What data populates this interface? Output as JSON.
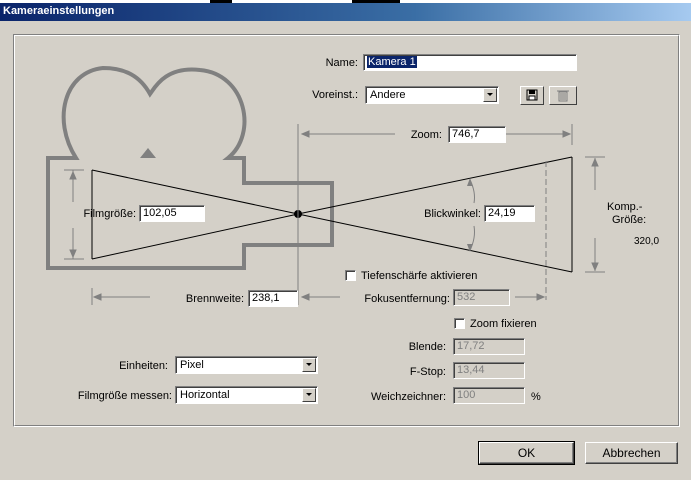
{
  "window": {
    "title": "Kameraeinstellungen"
  },
  "name": {
    "label": "Name:",
    "value": "Kamera 1"
  },
  "preset": {
    "label": "Voreinst.:",
    "value": "Andere"
  },
  "icons": {
    "save": "save-icon",
    "delete": "trash-icon"
  },
  "zoom": {
    "label": "Zoom:",
    "value": "746,7"
  },
  "film_size": {
    "label": "Filmgröße:",
    "value": "102,05"
  },
  "view_angle": {
    "label": "Blickwinkel:",
    "value": "24,19"
  },
  "comp_size": {
    "label_line1": "Komp.-",
    "label_line2": "Größe:",
    "value": "320,0"
  },
  "depth_of_field": {
    "label": "Tiefenschärfe aktivieren",
    "checked": false
  },
  "focal_length": {
    "label": "Brennweite:",
    "value": "238,1"
  },
  "focus_distance": {
    "label": "Fokusentfernung:",
    "value": "532"
  },
  "lock_zoom": {
    "label": "Zoom fixieren",
    "checked": false
  },
  "aperture": {
    "label": "Blende:",
    "value": "17,72"
  },
  "fstop": {
    "label": "F-Stop:",
    "value": "13,44"
  },
  "blur": {
    "label": "Weichzeichner:",
    "value": "100",
    "unit": "%"
  },
  "units": {
    "label": "Einheiten:",
    "value": "Pixel"
  },
  "measure_film": {
    "label": "Filmgröße messen:",
    "value": "Horizontal"
  },
  "buttons": {
    "ok": "OK",
    "cancel": "Abbrechen"
  },
  "colors": {
    "titlebar": "#0a246a",
    "dialog_bg": "#d4d0c8",
    "diagram_gray": "#808080"
  }
}
